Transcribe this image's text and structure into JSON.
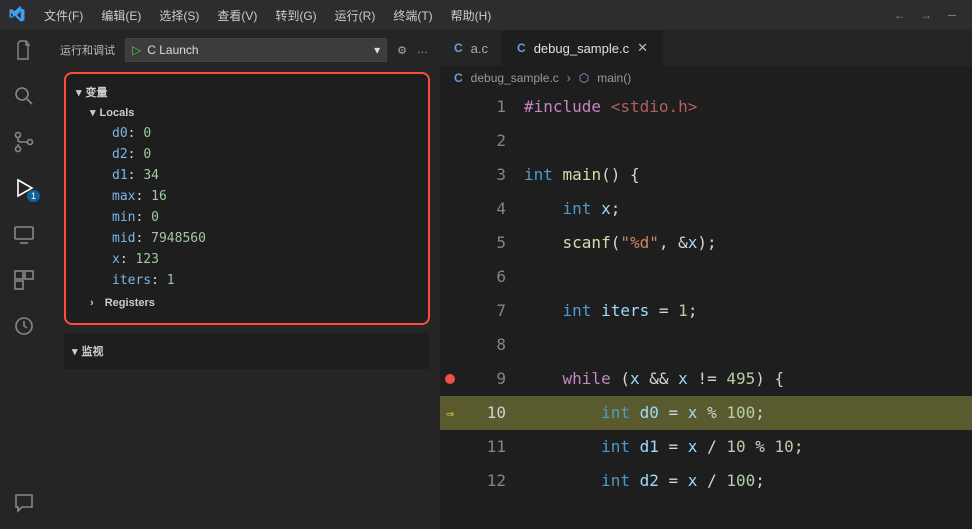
{
  "menu": {
    "file": "文件(F)",
    "edit": "编辑(E)",
    "selection": "选择(S)",
    "view": "查看(V)",
    "go": "转到(G)",
    "run": "运行(R)",
    "terminal": "终端(T)",
    "help": "帮助(H)"
  },
  "sidebar_header": {
    "title": "运行和调试",
    "launch_name": "C Launch"
  },
  "variables": {
    "section": "变量",
    "locals": "Locals",
    "registers": "Registers",
    "items": [
      {
        "n": "d0",
        "v": "0"
      },
      {
        "n": "d2",
        "v": "0"
      },
      {
        "n": "d1",
        "v": "34"
      },
      {
        "n": "max",
        "v": "16"
      },
      {
        "n": "min",
        "v": "0"
      },
      {
        "n": "mid",
        "v": "7948560"
      },
      {
        "n": "x",
        "v": "123"
      },
      {
        "n": "iters",
        "v": "1"
      }
    ]
  },
  "watch": {
    "section": "监视"
  },
  "tabs": {
    "a": "a.c",
    "b": "debug_sample.c"
  },
  "breadcrumb": {
    "file": "debug_sample.c",
    "symbol": "main()"
  },
  "run_badge": "1",
  "code": {
    "lines": [
      {
        "ln": "1",
        "html": "<span class='c-kw'>#include</span> <span class='c-inc'>&lt;stdio.h&gt;</span>"
      },
      {
        "ln": "2",
        "html": ""
      },
      {
        "ln": "3",
        "html": "<span class='c-type'>int</span> <span class='c-fn'>main</span><span class='c-plain'>() {</span>"
      },
      {
        "ln": "4",
        "html": "    <span class='c-type'>int</span> <span class='c-id'>x</span><span class='c-plain'>;</span>"
      },
      {
        "ln": "5",
        "html": "    <span class='c-fn'>scanf</span><span class='c-plain'>(</span><span class='c-str'>\"%d\"</span><span class='c-plain'>, &amp;</span><span class='c-id'>x</span><span class='c-plain'>);</span>"
      },
      {
        "ln": "6",
        "html": ""
      },
      {
        "ln": "7",
        "html": "    <span class='c-type'>int</span> <span class='c-id'>iters</span> <span class='c-op'>=</span> <span class='c-num'>1</span><span class='c-plain'>;</span>"
      },
      {
        "ln": "8",
        "html": ""
      },
      {
        "ln": "9",
        "html": "    <span class='c-kw'>while</span> <span class='c-plain'>(</span><span class='c-id'>x</span> <span class='c-op'>&amp;&amp;</span> <span class='c-id'>x</span> <span class='c-op'>!=</span> <span class='c-num'>495</span><span class='c-plain'>) {</span>",
        "bp": true
      },
      {
        "ln": "10",
        "html": "        <span class='c-type'>int</span> <span class='c-id'>d0</span> <span class='c-op'>=</span> <span class='c-id'>x</span> <span class='c-op'>%</span> <span class='c-num'>100</span><span class='c-plain'>;</span>",
        "cur": true
      },
      {
        "ln": "11",
        "html": "        <span class='c-type'>int</span> <span class='c-id'>d1</span> <span class='c-op'>=</span> <span class='c-id'>x</span> <span class='c-op'>/</span> <span class='c-num'>10</span> <span class='c-op'>%</span> <span class='c-num'>10</span><span class='c-plain'>;</span>"
      },
      {
        "ln": "12",
        "html": "        <span class='c-type'>int</span> <span class='c-id'>d2</span> <span class='c-op'>=</span> <span class='c-id'>x</span> <span class='c-op'>/</span> <span class='c-num'>100</span><span class='c-plain'>;</span>"
      }
    ]
  }
}
